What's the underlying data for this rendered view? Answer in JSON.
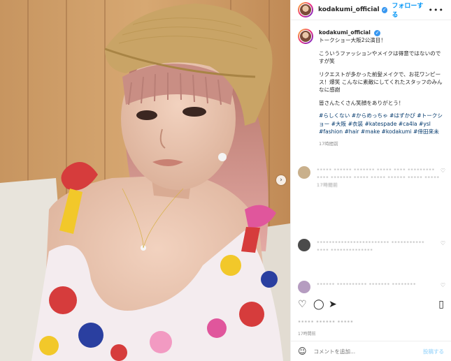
{
  "post": {
    "username": "kodakumi_official",
    "follow_label": "フォローする",
    "more_label": "•••",
    "verified_glyph": "✓"
  },
  "caption": {
    "username": "kodakumi_official",
    "lines": [
      "トークショー大阪2公演目！",
      "こういうファッションやメイクは得意ではないのですが笑",
      "リクエストが多かった前髪メイクで、お花ワンピース！爆笑 こんなに素敵にしてくれたスタッフのみんなに感謝",
      "皆さんたくさん笑顔をありがとう！"
    ],
    "hashtags": "#らしくない #からめっちゃ #はずかぴ #トークショー #大阪 #衣装 #katespade #ca4la #ysl #fashion #hair #make #kodakumi #倖田來未",
    "time": "17時間前"
  },
  "comments": [
    {
      "text": "••••• •••••• ••••••• ••••• •••• ••••••••• •••• ••••••• ••••• ••••• •••••• ••••• •••••",
      "meta": "17時間前"
    },
    {
      "text": "•••••••••••••••••••••••• •••••••••••",
      "meta": "•••• ••••••••••••••"
    },
    {
      "text": "•••••• •••••••••• ••••••• ••••••••",
      "meta": ""
    }
  ],
  "likes_text": "••••• •••••• •••••",
  "post_time": "17時間前",
  "comment_input": {
    "placeholder": "コメントを追加...",
    "post_label": "投稿する"
  },
  "colors": {
    "accent": "#0095f6",
    "hashtag": "#00376b",
    "muted": "#8e8e8e"
  }
}
